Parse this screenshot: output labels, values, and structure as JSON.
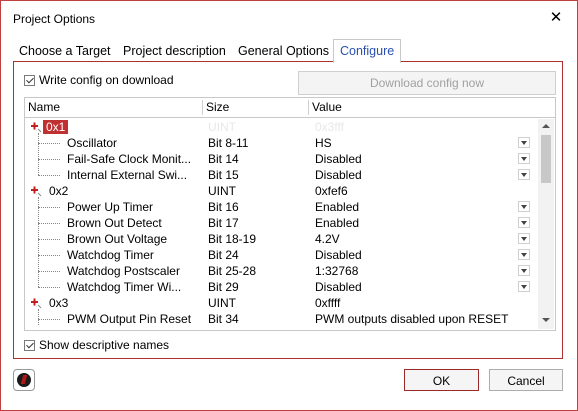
{
  "window": {
    "title": "Project Options"
  },
  "tabs": [
    {
      "label": "Choose a Target"
    },
    {
      "label": "Project description"
    },
    {
      "label": "General Options"
    },
    {
      "label": "Configure",
      "active": true
    }
  ],
  "configure": {
    "write_config_label": "Write config on download",
    "write_config_checked": true,
    "download_button_label": "Download config now",
    "download_button_enabled": false,
    "columns": {
      "name": "Name",
      "size": "Size",
      "value": "Value"
    },
    "groups": [
      {
        "name": "0x1",
        "size": "UINT",
        "value": "0x3fff",
        "items": [
          {
            "name": "Oscillator",
            "size": "Bit 8-11",
            "value": "HS"
          },
          {
            "name": "Fail-Safe Clock Monit...",
            "size": "Bit 14",
            "value": "Disabled"
          },
          {
            "name": "Internal External Swi...",
            "size": "Bit 15",
            "value": "Disabled"
          }
        ]
      },
      {
        "name": "0x2",
        "size": "UINT",
        "value": "0xfef6",
        "items": [
          {
            "name": "Power Up Timer",
            "size": "Bit 16",
            "value": "Enabled"
          },
          {
            "name": "Brown Out Detect",
            "size": "Bit 17",
            "value": "Enabled"
          },
          {
            "name": "Brown Out Voltage",
            "size": "Bit 18-19",
            "value": "4.2V"
          },
          {
            "name": "Watchdog Timer",
            "size": "Bit 24",
            "value": "Disabled"
          },
          {
            "name": "Watchdog Postscaler",
            "size": "Bit 25-28",
            "value": "1:32768"
          },
          {
            "name": "Watchdog Timer Wi...",
            "size": "Bit 29",
            "value": "Disabled"
          }
        ]
      },
      {
        "name": "0x3",
        "size": "UINT",
        "value": "0xffff",
        "items": [
          {
            "name": "PWM Output Pin Reset",
            "size": "Bit 34",
            "value": "PWM outputs disabled upon RESET"
          }
        ]
      }
    ],
    "show_descriptive_label": "Show descriptive names",
    "show_descriptive_checked": true
  },
  "buttons": {
    "ok": "OK",
    "cancel": "Cancel"
  },
  "colors": {
    "accent_border": "#c04040",
    "tab_active_text": "#2a4fb0",
    "selected_group_bg": "#c03030"
  }
}
